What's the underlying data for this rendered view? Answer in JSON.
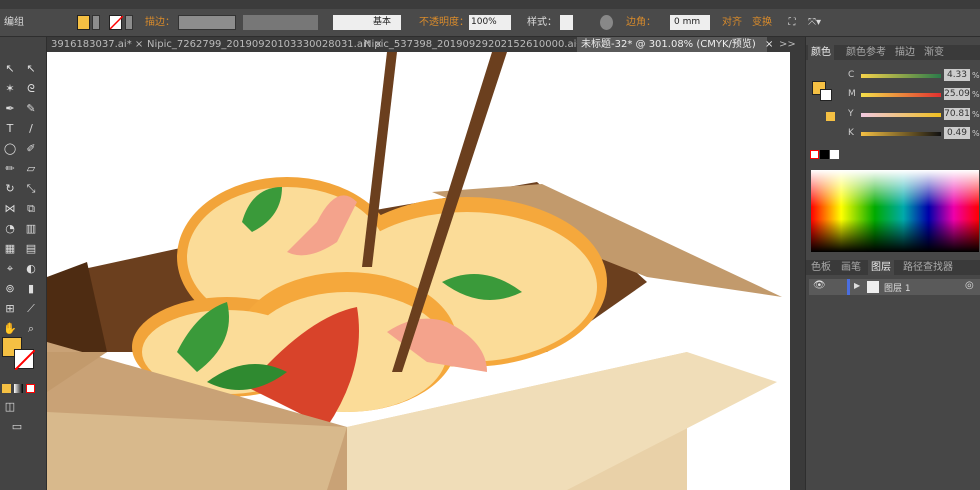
{
  "control_bar": {
    "selection_label": "编组",
    "stroke_label": "描边：",
    "stroke_style": "基本",
    "opacity_label": "不透明度：",
    "opacity_value": "100%",
    "style_label": "样式：",
    "corner_label": "边角：",
    "corner_value": "0 mm",
    "align_label": "对齐",
    "transform_label": "变换"
  },
  "doc_tabs": [
    {
      "label": "3916183037.ai*",
      "close": "×"
    },
    {
      "label": "Nipic_7262799_20190920103330028031.ai*",
      "close": "×"
    },
    {
      "label": "Nipic_537398_20190929202152610000.ai*",
      "close": "×"
    },
    {
      "label": "未标题-32* @ 301.08% (CMYK/预览)",
      "close": "×",
      "active": true
    }
  ],
  "tabs_overflow": ">>",
  "color_panel": {
    "tabs": [
      "颜色",
      "颜色参考",
      "描边",
      "渐变"
    ],
    "channels": [
      {
        "label": "C",
        "value": "4.33",
        "fraction": 0.0433
      },
      {
        "label": "M",
        "value": "25.09",
        "fraction": 0.2509
      },
      {
        "label": "Y",
        "value": "70.81",
        "fraction": 0.7081
      },
      {
        "label": "K",
        "value": "0.49",
        "fraction": 0.0049
      }
    ],
    "percent": "%",
    "fill_color": "#f5c043"
  },
  "layers_panel": {
    "tabs": [
      "色板",
      "画笔",
      "图层",
      "路径查找器"
    ],
    "layers": [
      {
        "name": "图层 1"
      }
    ]
  },
  "colors": {
    "accent": "#d98b2b",
    "fill": "#f5c043"
  }
}
